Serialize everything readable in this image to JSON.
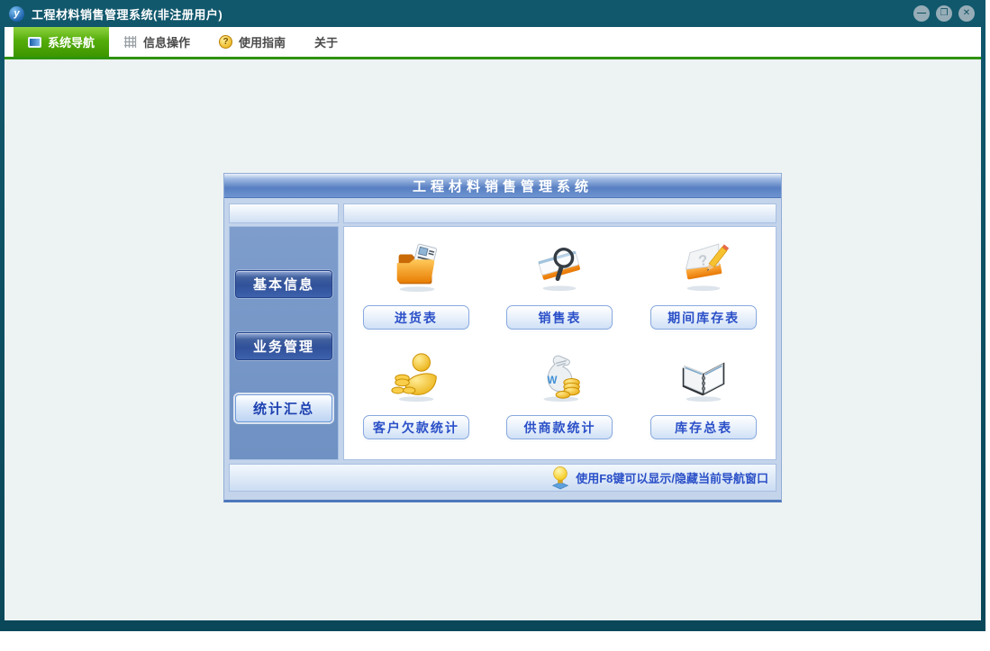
{
  "window": {
    "title": "工程材料销售管理系统(非注册用户)",
    "logo_letter": "y",
    "controls": {
      "minimize": "—",
      "restore": "❐",
      "close": "✕"
    }
  },
  "toolbar": {
    "items": [
      {
        "label": "系统导航",
        "icon": "navigation-icon",
        "active": true
      },
      {
        "label": "信息操作",
        "icon": "grid-icon",
        "active": false
      },
      {
        "label": "使用指南",
        "icon": "help-coin-icon",
        "glyph": "?",
        "active": false
      },
      {
        "label": "关于",
        "icon": "",
        "active": false
      }
    ]
  },
  "panel": {
    "title": "工程材料销售管理系统",
    "sidebar": {
      "buttons": [
        {
          "label": "基本信息",
          "state": "normal"
        },
        {
          "label": "业务管理",
          "state": "normal"
        },
        {
          "label": "统计汇总",
          "state": "active"
        }
      ]
    },
    "grid": [
      {
        "label": "进货表",
        "icon": "purchase-folder-icon"
      },
      {
        "label": "销售表",
        "icon": "sales-search-icon"
      },
      {
        "label": "期间库存表",
        "icon": "period-inventory-icon"
      },
      {
        "label": "客户欠款统计",
        "icon": "customer-debt-icon"
      },
      {
        "label": "供商款统计",
        "icon": "supplier-payment-icon"
      },
      {
        "label": "库存总表",
        "icon": "inventory-book-icon"
      }
    ],
    "footer": {
      "tip": "使用F8键可以显示/隐藏当前导航窗口",
      "icon": "lightbulb-icon"
    }
  },
  "colors": {
    "titlebar": "#0B4C5F",
    "toolbar_active_green": "#4FAA08",
    "divider_green": "#2F930C",
    "content_bg": "#EDF2F3",
    "panel_header_blue": "#5C83C4",
    "sidebar_blue": "#7495C7",
    "button_text_blue": "#2B50C8",
    "dark_button_blue": "#33549E"
  }
}
